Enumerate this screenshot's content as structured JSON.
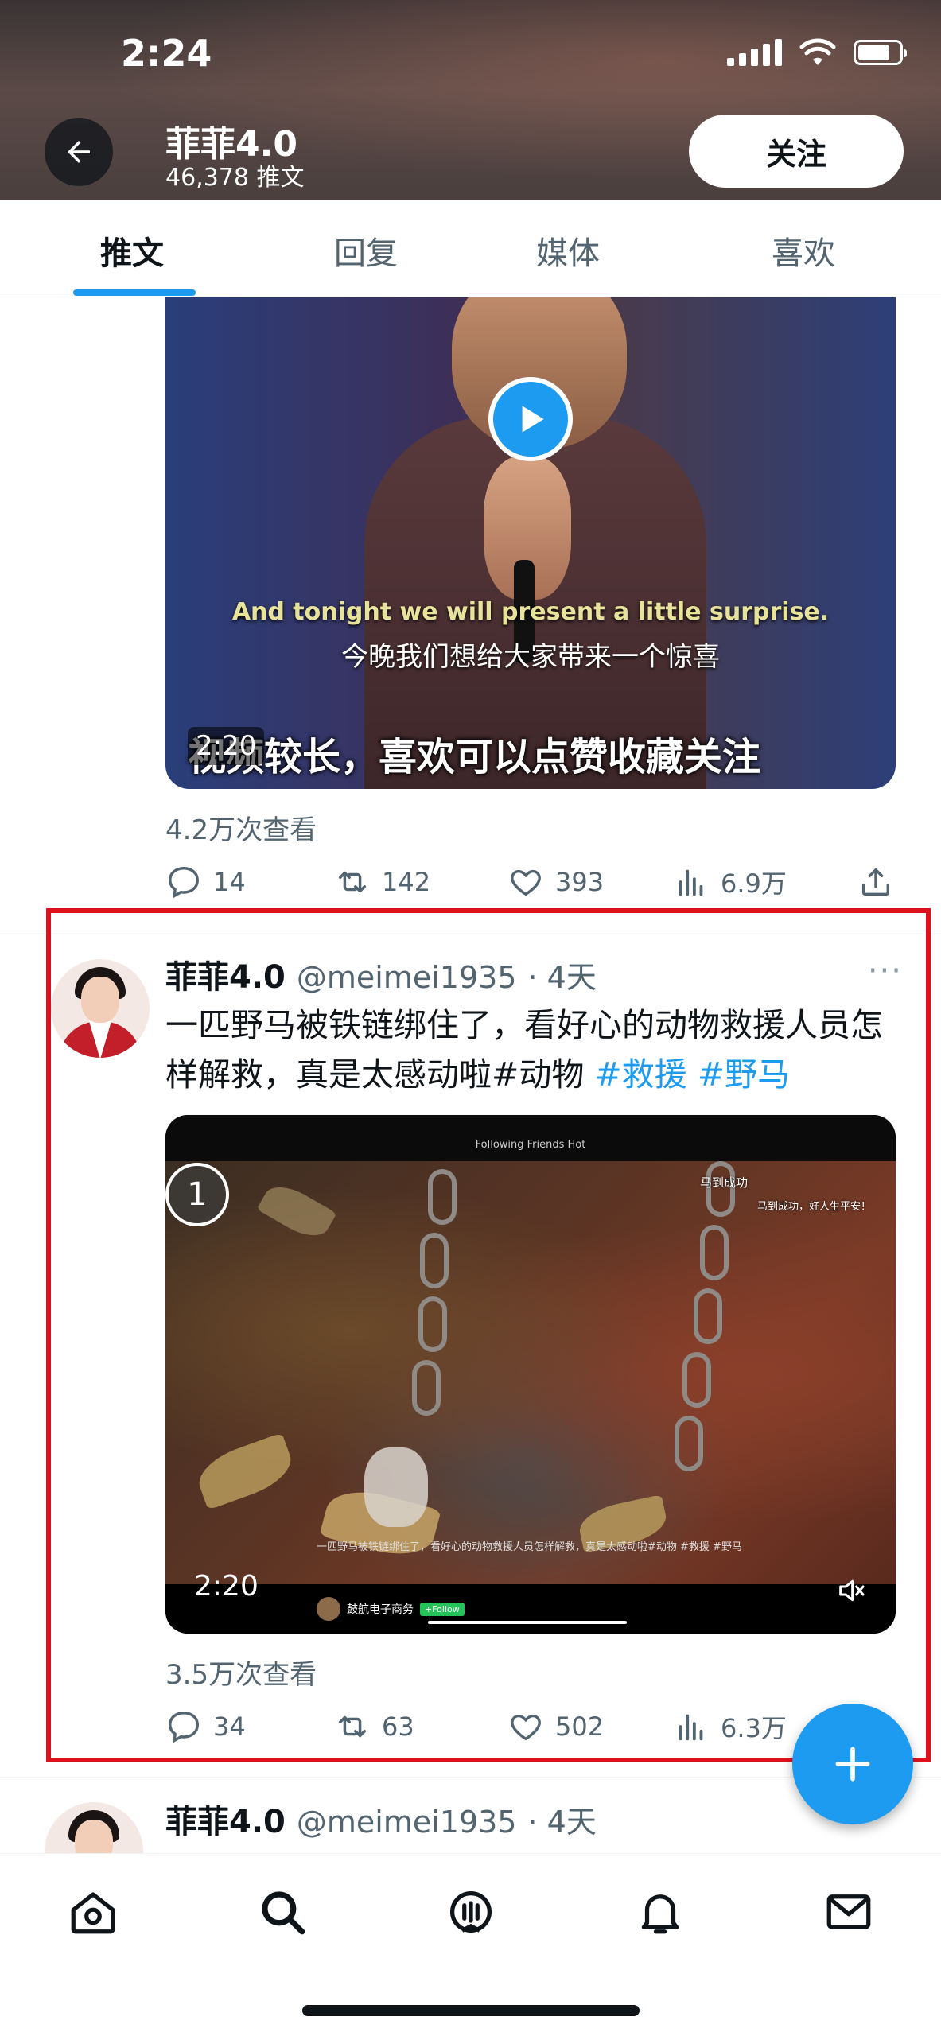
{
  "status_bar": {
    "time": "2:24"
  },
  "profile": {
    "name": "菲菲4.0",
    "post_count": "46,378 推文",
    "follow_label": "关注"
  },
  "tabs": [
    {
      "label": "推文",
      "active": true
    },
    {
      "label": "回复",
      "active": false
    },
    {
      "label": "媒体",
      "active": false
    },
    {
      "label": "喜欢",
      "active": false
    }
  ],
  "tweet1": {
    "video": {
      "subtitle_en": "And tonight we will present a little surprise.",
      "subtitle_cn": "今晚我们想给大家带来一个惊喜",
      "overlay_text": "视频较长，喜欢可以点赞收藏关注",
      "duration": "2:20"
    },
    "views": "4.2万次查看",
    "replies": "14",
    "retweets": "142",
    "likes": "393",
    "analytics": "6.9万"
  },
  "tweet2": {
    "name": "菲菲4.0",
    "handle": "@meimei1935",
    "time": "· 4天",
    "text": "一匹野马被铁链绑住了，看好心的动物救援人员怎样解救，真是太感动啦#动物",
    "hashtags": [
      "#救援",
      "#野马"
    ],
    "video": {
      "badge": "1",
      "tabs": "Following   Friends   Hot",
      "overlay_1": "马到成功",
      "overlay_2": "马到成功，好人生平安！",
      "caption": "一匹野马被铁链绑住了，看好心的动物救援人员怎样解救，真是太感动啦#动物 #救援 #野马",
      "author": "鼓航电子商务",
      "author_follow": "+Follow",
      "duration": "2:20"
    },
    "views": "3.5万次查看",
    "replies": "34",
    "retweets": "63",
    "likes": "502",
    "analytics": "6.3万"
  },
  "tweet3": {
    "name": "菲菲4.0",
    "handle": "@meimei1935",
    "time": "· 4天"
  },
  "colors": {
    "accent": "#1d9bf0",
    "highlight": "#e0111f",
    "muted_text": "#536471"
  },
  "icons": [
    "back-arrow-icon",
    "play-icon",
    "reply-icon",
    "retweet-icon",
    "like-icon",
    "analytics-icon",
    "share-icon",
    "more-icon",
    "mute-icon",
    "compose-plus-icon",
    "home-icon",
    "search-icon",
    "spaces-icon",
    "notifications-icon",
    "messages-icon"
  ]
}
